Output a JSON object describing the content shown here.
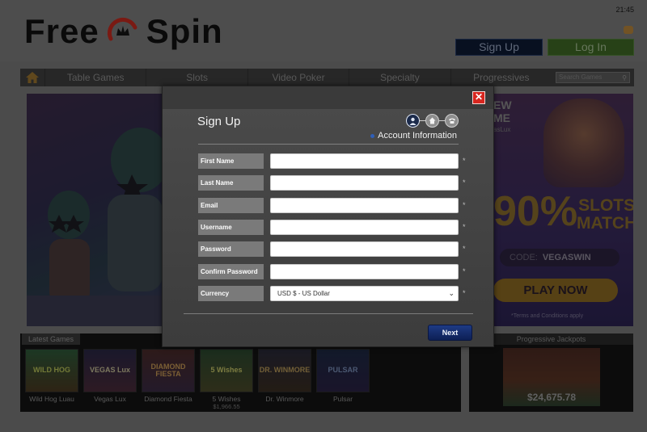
{
  "status_bar": {
    "time": "21:45"
  },
  "brand": {
    "logo_left": "Free",
    "logo_right": "Spin"
  },
  "header": {
    "signup_label": "Sign Up",
    "login_label": "Log In"
  },
  "nav": {
    "items": [
      "Table Games",
      "Slots",
      "Video Poker",
      "Specialty",
      "Progressives"
    ],
    "search_placeholder": "Search Games"
  },
  "promo": {
    "headline_fragment": "EW\nME",
    "sub_fragment": "asLux",
    "percent": "90%",
    "slots_match": "SLOTS\nMATCH",
    "code_label": "CODE:",
    "code_value": "VEGASWIN",
    "play_now": "PLAY NOW",
    "terms": "*Terms and Conditions apply"
  },
  "latest_games": {
    "tab_label": "Latest Games",
    "games": [
      {
        "name": "Wild Hog Luau",
        "thumb_text": "WILD HOG",
        "jackpot": ""
      },
      {
        "name": "Vegas Lux",
        "thumb_text": "VEGAS Lux",
        "jackpot": ""
      },
      {
        "name": "Diamond Fiesta",
        "thumb_text": "DIAMOND FIESTA",
        "jackpot": ""
      },
      {
        "name": "5 Wishes",
        "thumb_text": "5 Wishes",
        "jackpot": "$1,966.55"
      },
      {
        "name": "Dr. Winmore",
        "thumb_text": "DR. WINMORE",
        "jackpot": ""
      },
      {
        "name": "Pulsar",
        "thumb_text": "PULSAR",
        "jackpot": ""
      }
    ]
  },
  "progressive": {
    "title": "Progressive Jackpots",
    "amount": "$24,675.78"
  },
  "modal": {
    "title": "Sign Up",
    "step_caption": "Account Information",
    "fields": [
      {
        "label": "First Name",
        "value": ""
      },
      {
        "label": "Last Name",
        "value": ""
      },
      {
        "label": "Email",
        "value": ""
      },
      {
        "label": "Username",
        "value": ""
      },
      {
        "label": "Password",
        "value": ""
      },
      {
        "label": "Confirm Password",
        "value": ""
      }
    ],
    "currency": {
      "label": "Currency",
      "selected": "USD $ - US Dollar"
    },
    "required_mark": "*",
    "next_label": "Next",
    "close_glyph": "✕"
  },
  "colors": {
    "accent_red": "#d8261f",
    "next_blue": "#1e3b84",
    "signup_bg": "#0e1a34",
    "login_bg": "#3f6a26"
  }
}
